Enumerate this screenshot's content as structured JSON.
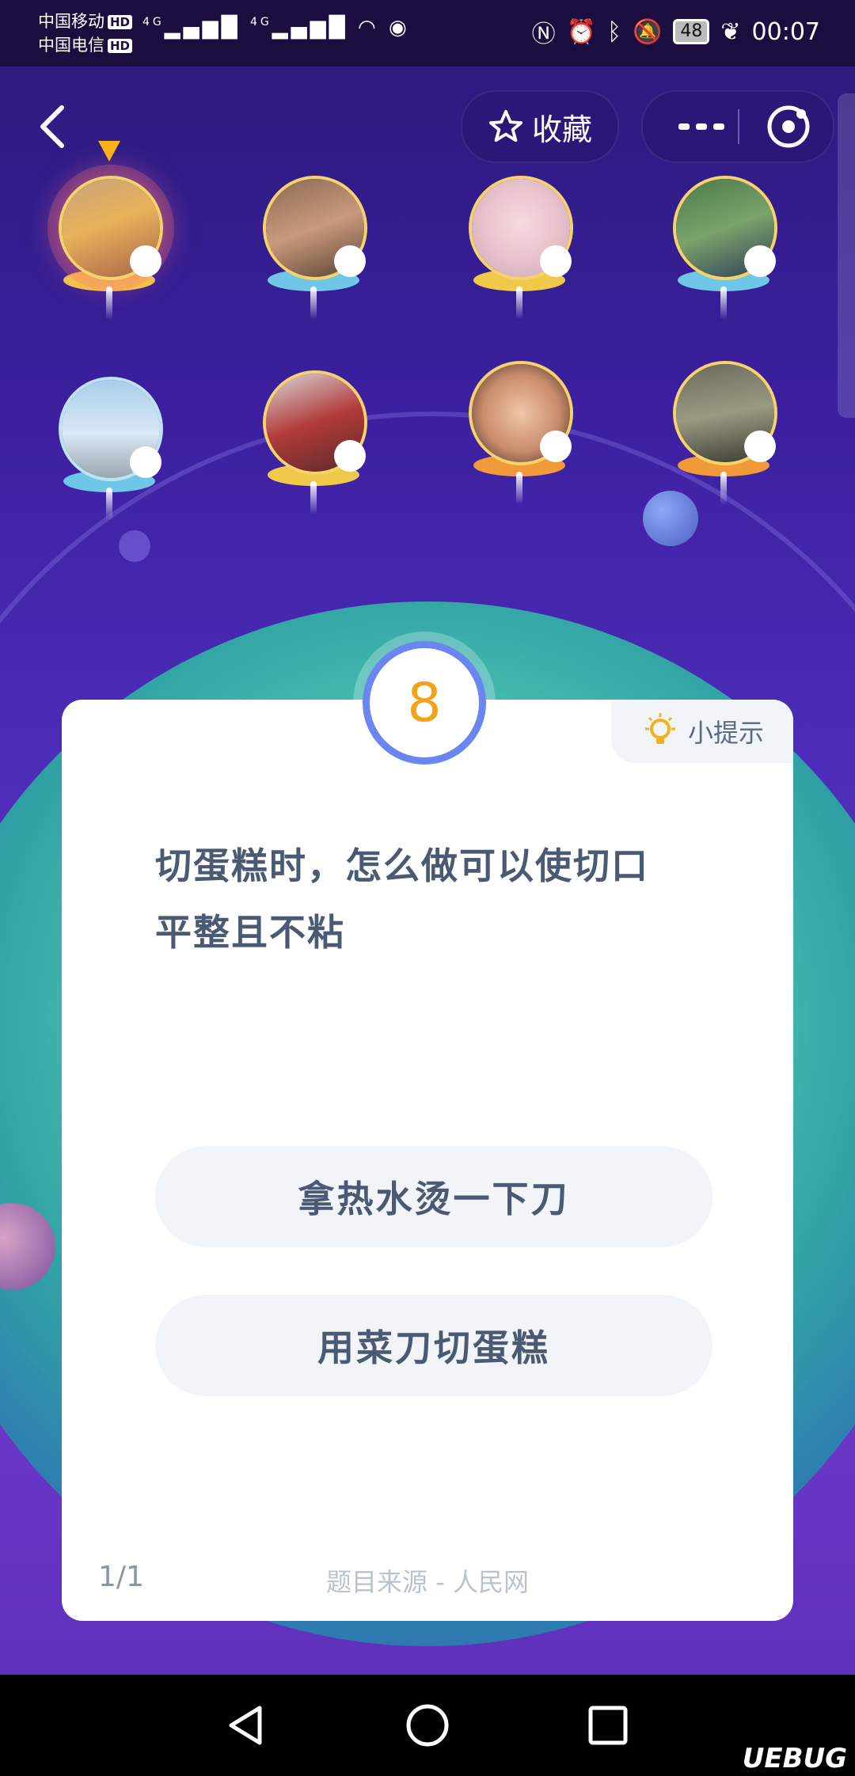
{
  "status_bar": {
    "carrier1": "中国移动",
    "carrier2": "中国电信",
    "hd": "HD",
    "network": "4G",
    "battery": "48",
    "time": "00:07"
  },
  "header": {
    "favorite_label": "收藏"
  },
  "card": {
    "number": "8",
    "hint_label": "小提示",
    "question_line1": "切蛋糕时，怎么做可以使切口",
    "question_line2": "平整且不粘",
    "options": [
      "拿热水烫一下刀",
      "用菜刀切蛋糕"
    ],
    "progress": "1/1",
    "source": "题目来源 - 人民网"
  },
  "watermark": "UEBUG",
  "colors": {
    "accent_blue": "#6a86f0",
    "number_orange": "#f4a21a",
    "pointer_orange": "#ffb21a",
    "text_dark": "#4b5a73"
  }
}
